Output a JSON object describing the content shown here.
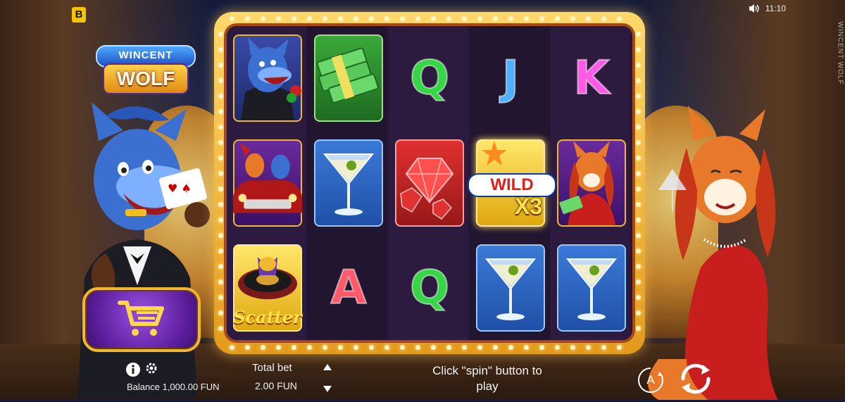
{
  "game": {
    "brand_badge": "B",
    "logo_top": "WINCENT",
    "logo_bottom": "WOLF",
    "side_text": "WINCENT WOLF"
  },
  "status": {
    "time": "11:10",
    "sound_icon": "speaker-icon"
  },
  "reels": {
    "columns": 5,
    "rows": 3,
    "symbols": [
      [
        "wolf",
        "car",
        "scatter"
      ],
      [
        "money",
        "martini",
        "A"
      ],
      [
        "Q",
        "gems",
        "Q"
      ],
      [
        "J",
        "wild",
        "martini"
      ],
      [
        "K",
        "fox",
        "martini"
      ]
    ],
    "wild_label": "WILD",
    "wild_multiplier": "X3",
    "scatter_label": "Scatter",
    "letter_Q": "Q",
    "letter_J": "J",
    "letter_K": "K",
    "letter_A": "A"
  },
  "controls": {
    "balance": "Balance 1,000.00 FUN",
    "total_bet_label": "Total bet",
    "total_bet_value": "2.00 FUN",
    "hint": "Click \"spin\" button to play",
    "autoplay_label": "A"
  },
  "colors": {
    "frame_gold": "#f0b830",
    "reel_bg": "#241634",
    "cart_purple": "#5a1c9a"
  }
}
